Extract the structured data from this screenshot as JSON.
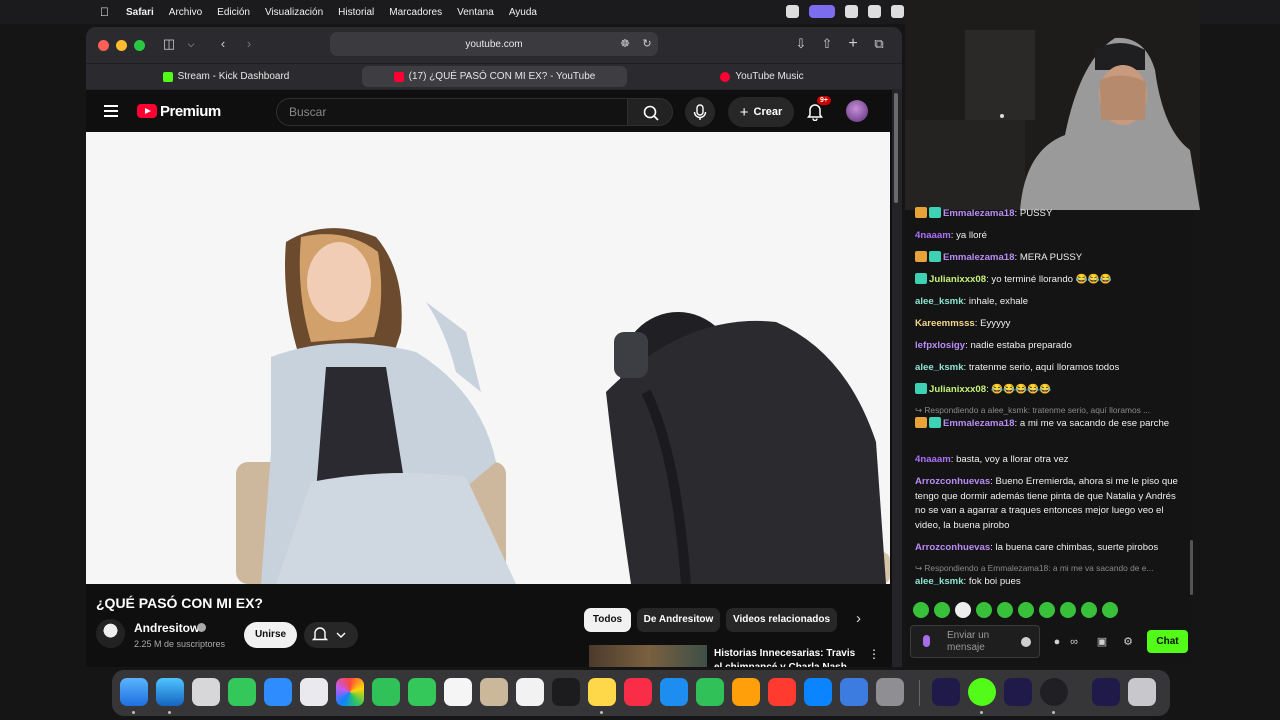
{
  "menubar": {
    "items": [
      "Safari",
      "Archivo",
      "Edición",
      "Visualización",
      "Historial",
      "Marcadores",
      "Ventana",
      "Ayuda"
    ]
  },
  "browser": {
    "url": "youtube.com",
    "tabs": [
      {
        "label": "Stream - Kick Dashboard",
        "color": "#53fc18"
      },
      {
        "label": "(17) ¿QUÉ PASÓ CON MI EX? - YouTube",
        "color": "#ff0033"
      },
      {
        "label": "YouTube Music",
        "color": "#ff0033"
      }
    ]
  },
  "youtube": {
    "brand": "Premium",
    "search_placeholder": "Buscar",
    "create_label": "Crear",
    "notification_badge": "9+",
    "video_title": "¿QUÉ PASÓ CON MI EX?",
    "channel_name": "Andresitow",
    "subscribers": "2.25 M de suscriptores",
    "join_label": "Unirse",
    "chips": [
      "Todos",
      "De Andresitow",
      "Videos relacionados"
    ],
    "recommended_title": "Historias Innecesarias: Travis el chimpancé y Charla Nash"
  },
  "chat": {
    "messages": [
      {
        "user": "Emmalezama18",
        "color": "#b98cf5",
        "text": "PUSSY",
        "badges": [
          "crown",
          "sub"
        ]
      },
      {
        "user": "4naaam",
        "color": "#a970ff",
        "text": "ya lloré",
        "badges": []
      },
      {
        "user": "Emmalezama18",
        "color": "#b98cf5",
        "text": "MERA PUSSY",
        "badges": [
          "crown",
          "sub"
        ]
      },
      {
        "user": "Julianixxx08",
        "color": "#c7f27a",
        "text": "yo terminé llorando 😂😂😂",
        "badges": [
          "sub"
        ]
      },
      {
        "user": "alee_ksmk",
        "color": "#8fe3d3",
        "text": "inhale, exhale",
        "badges": []
      },
      {
        "user": "Kareemmsss",
        "color": "#f5d58f",
        "text": "Eyyyyy",
        "badges": []
      },
      {
        "user": "lefpxlosigy",
        "color": "#b98cf5",
        "text": "nadie estaba preparado",
        "badges": []
      },
      {
        "user": "alee_ksmk",
        "color": "#8fe3d3",
        "text": "tratenme serio, aquí lloramos todos",
        "badges": []
      },
      {
        "user": "Julianixxx08",
        "color": "#c7f27a",
        "text": "😂😂😂😂😂",
        "badges": [
          "sub"
        ]
      },
      {
        "reply": "Respondiendo a alee_ksmk: tratenme serio, aquí lloramos ...",
        "user": "Emmalezama18",
        "color": "#b98cf5",
        "text": "a mi me va sacando de ese parche",
        "badges": [
          "crown",
          "sub"
        ]
      },
      {
        "user": "4naaam",
        "color": "#a970ff",
        "text": "basta, voy a llorar otra vez",
        "badges": []
      },
      {
        "user": "Arrozconhuevas",
        "color": "#b98cf5",
        "text": "Bueno Erremierda, ahora si me le piso que tengo que dormir además tiene pinta de que Natalia y Andrés no se van a agarrar a traques entonces mejor luego veo el video, la buena pirobo",
        "badges": []
      },
      {
        "user": "Arrozconhuevas",
        "color": "#b98cf5",
        "text": "la buena care chimbas, suerte pirobos",
        "badges": []
      },
      {
        "reply": "Respondiendo a Emmalezama18: a mi me va sacando de e...",
        "user": "alee_ksmk",
        "color": "#8fe3d3",
        "text": "fok boi pues",
        "badges": []
      }
    ],
    "input_placeholder": "Enviar un mensaje",
    "chat_button": "Chat"
  },
  "colors": {
    "kick_green": "#53fc18",
    "youtube_red": "#ff0033"
  }
}
